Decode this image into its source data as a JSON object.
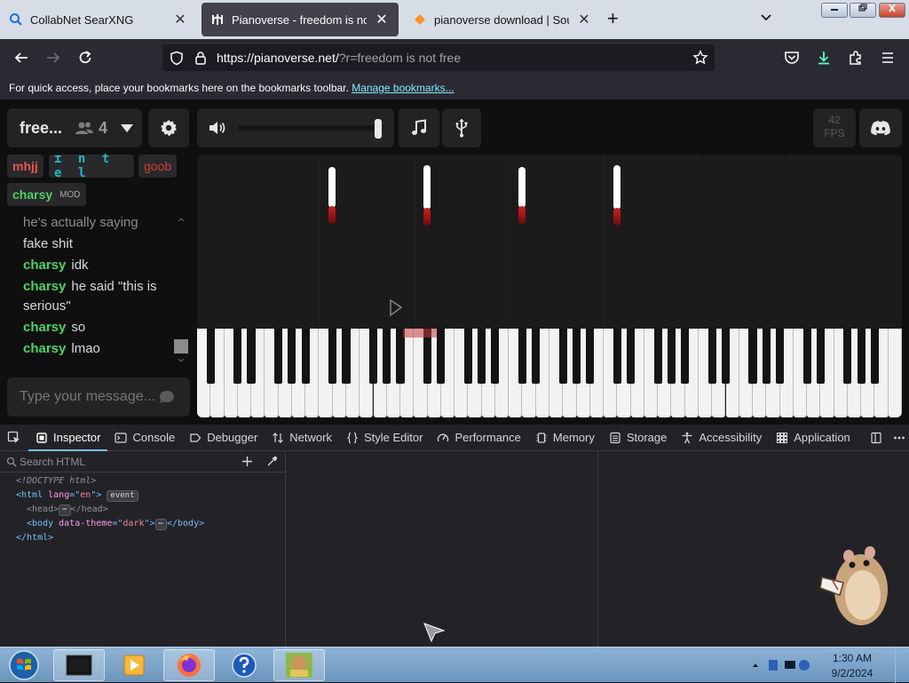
{
  "browser": {
    "tabs": [
      {
        "title": "CollabNet SearXNG",
        "active": false
      },
      {
        "title": "Pianoverse - freedom is not free",
        "active": true
      },
      {
        "title": "pianoverse download | SourceF",
        "active": false
      }
    ],
    "url_main": "https://pianoverse.net/",
    "url_query": "?r=freedom is not free",
    "bookmarks_msg": "For quick access, place your bookmarks here on the bookmarks toolbar.",
    "bookmarks_link": "Manage bookmarks..."
  },
  "room": {
    "name": "free...",
    "user_count": "4",
    "users": [
      {
        "name": "mhjj",
        "color": "#e0574f"
      },
      {
        "name": "ɪ n t e l",
        "color": "#23b9c0"
      },
      {
        "name": "goob",
        "color": "#d43b33"
      },
      {
        "name": "charsy",
        "color": "#4fd066",
        "badge": "MOD"
      }
    ],
    "fps_value": "42",
    "fps_label": "FPS"
  },
  "chat": {
    "messages": [
      {
        "user": "",
        "text": "he's actually saying"
      },
      {
        "user": "",
        "text": "fake shit"
      },
      {
        "user": "charsy",
        "text": "idk"
      },
      {
        "user": "charsy",
        "text": "he said \"this is serious\""
      },
      {
        "user": "charsy",
        "text": "so"
      },
      {
        "user": "charsy",
        "text": "lmao"
      }
    ],
    "input_placeholder": "Type your message..."
  },
  "controls": {
    "volume_level": 0.96
  },
  "devtools": {
    "tabs": [
      "Inspector",
      "Console",
      "Debugger",
      "Network",
      "Style Editor",
      "Performance",
      "Memory",
      "Storage",
      "Accessibility",
      "Application"
    ],
    "active_tab": "Inspector",
    "search_placeholder": "Search HTML",
    "tree": {
      "doctype": "<!DOCTYPE html>",
      "html_lang": "en",
      "event_badge": "event",
      "body_theme": "dark"
    }
  },
  "taskbar": {
    "time": "1:30 AM",
    "date": "9/2/2024"
  }
}
